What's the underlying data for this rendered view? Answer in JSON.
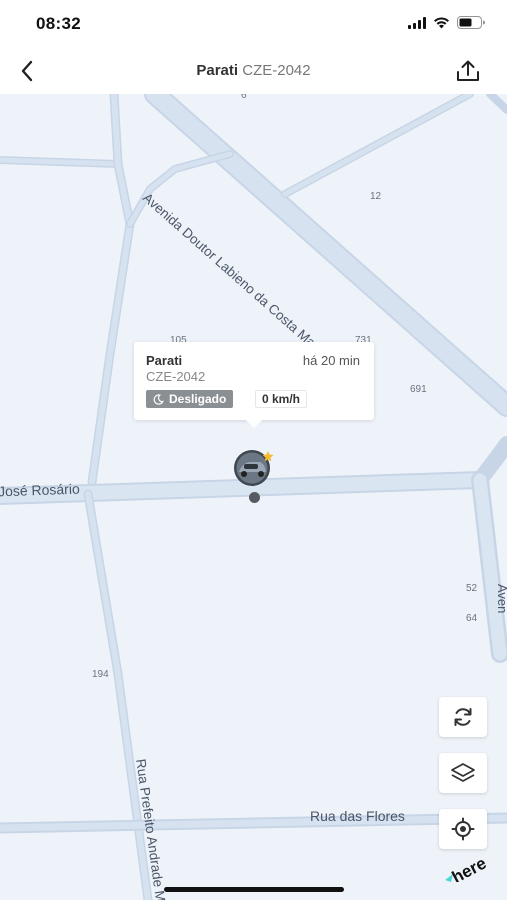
{
  "status_bar": {
    "time": "08:32"
  },
  "header": {
    "name": "Parati",
    "plate": "CZE-2042"
  },
  "map": {
    "streets": {
      "avenida": "Avenida Doutor Labieno da Costa Machado",
      "jose_rosario": "José Rosário",
      "rua_flores": "Rua das Flores",
      "rua_prefeito": "Rua Prefeito Andrade M",
      "avenida_right": "Aven"
    },
    "numbers": {
      "n6": "6",
      "n12": "12",
      "n105": "105",
      "n731": "731",
      "n691": "691",
      "n52": "52",
      "n64": "64",
      "n194": "194"
    }
  },
  "popup": {
    "name": "Parati",
    "time_ago": "há 20 min",
    "plate": "CZE-2042",
    "status": "Desligado",
    "speed": "0 km/h"
  },
  "attribution": "here"
}
